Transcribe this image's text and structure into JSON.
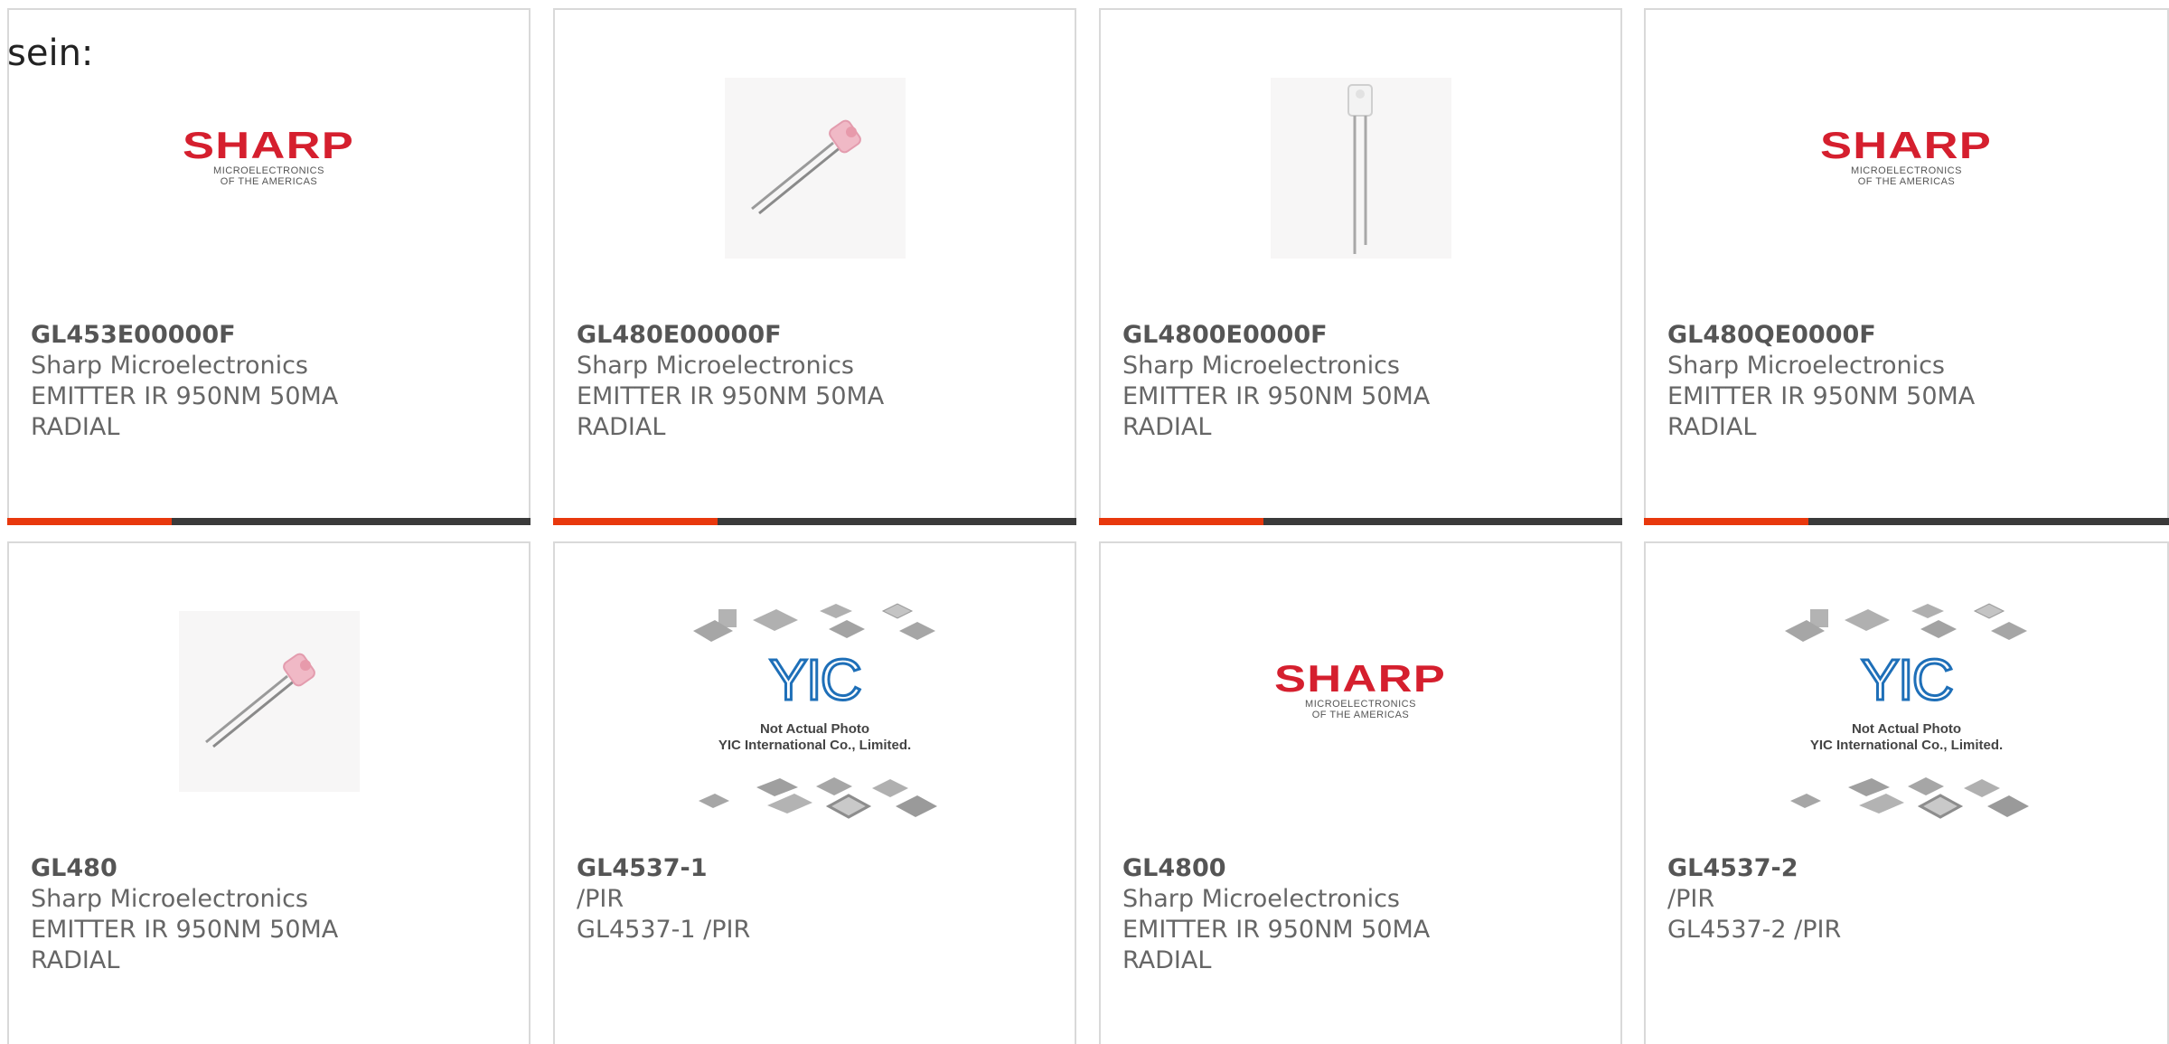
{
  "lead_text": "sein:",
  "colors": {
    "accent": "#e8380d",
    "bar": "#3a3a3a",
    "sharp_red": "#d51f2e",
    "yic_blue": "#1e6fb8"
  },
  "logos": {
    "sharp_word": "SHARP",
    "sharp_sub": "MICROELECTRONICS\nOF THE AMERICAS",
    "yic_letters": "YIC",
    "yic_caption": "Not Actual Photo\nYIC International Co., Limited."
  },
  "products": [
    {
      "part": "GL453E00000F",
      "maker": "Sharp Microelectronics",
      "line1": "EMITTER IR 950NM 50MA",
      "line2": "RADIAL",
      "image": "sharp-logo"
    },
    {
      "part": "GL480E00000F",
      "maker": "Sharp Microelectronics",
      "line1": "EMITTER IR 950NM 50MA",
      "line2": "RADIAL",
      "image": "led-photo-angled"
    },
    {
      "part": "GL4800E0000F",
      "maker": "Sharp Microelectronics",
      "line1": "EMITTER IR 950NM 50MA",
      "line2": "RADIAL",
      "image": "led-photo-vertical"
    },
    {
      "part": "GL480QE0000F",
      "maker": "Sharp Microelectronics",
      "line1": "EMITTER IR 950NM 50MA",
      "line2": "RADIAL",
      "image": "sharp-logo"
    },
    {
      "part": "GL480",
      "maker": "Sharp Microelectronics",
      "line1": "EMITTER IR 950NM 50MA",
      "line2": "RADIAL",
      "image": "led-photo-angled"
    },
    {
      "part": "GL4537-1",
      "maker": "/PIR",
      "line1": "GL4537-1 /PIR",
      "line2": "",
      "image": "yic-placeholder"
    },
    {
      "part": "GL4800",
      "maker": "Sharp Microelectronics",
      "line1": "EMITTER IR 950NM 50MA",
      "line2": "RADIAL",
      "image": "sharp-logo"
    },
    {
      "part": "GL4537-2",
      "maker": "/PIR",
      "line1": "GL4537-2 /PIR",
      "line2": "",
      "image": "yic-placeholder"
    }
  ]
}
